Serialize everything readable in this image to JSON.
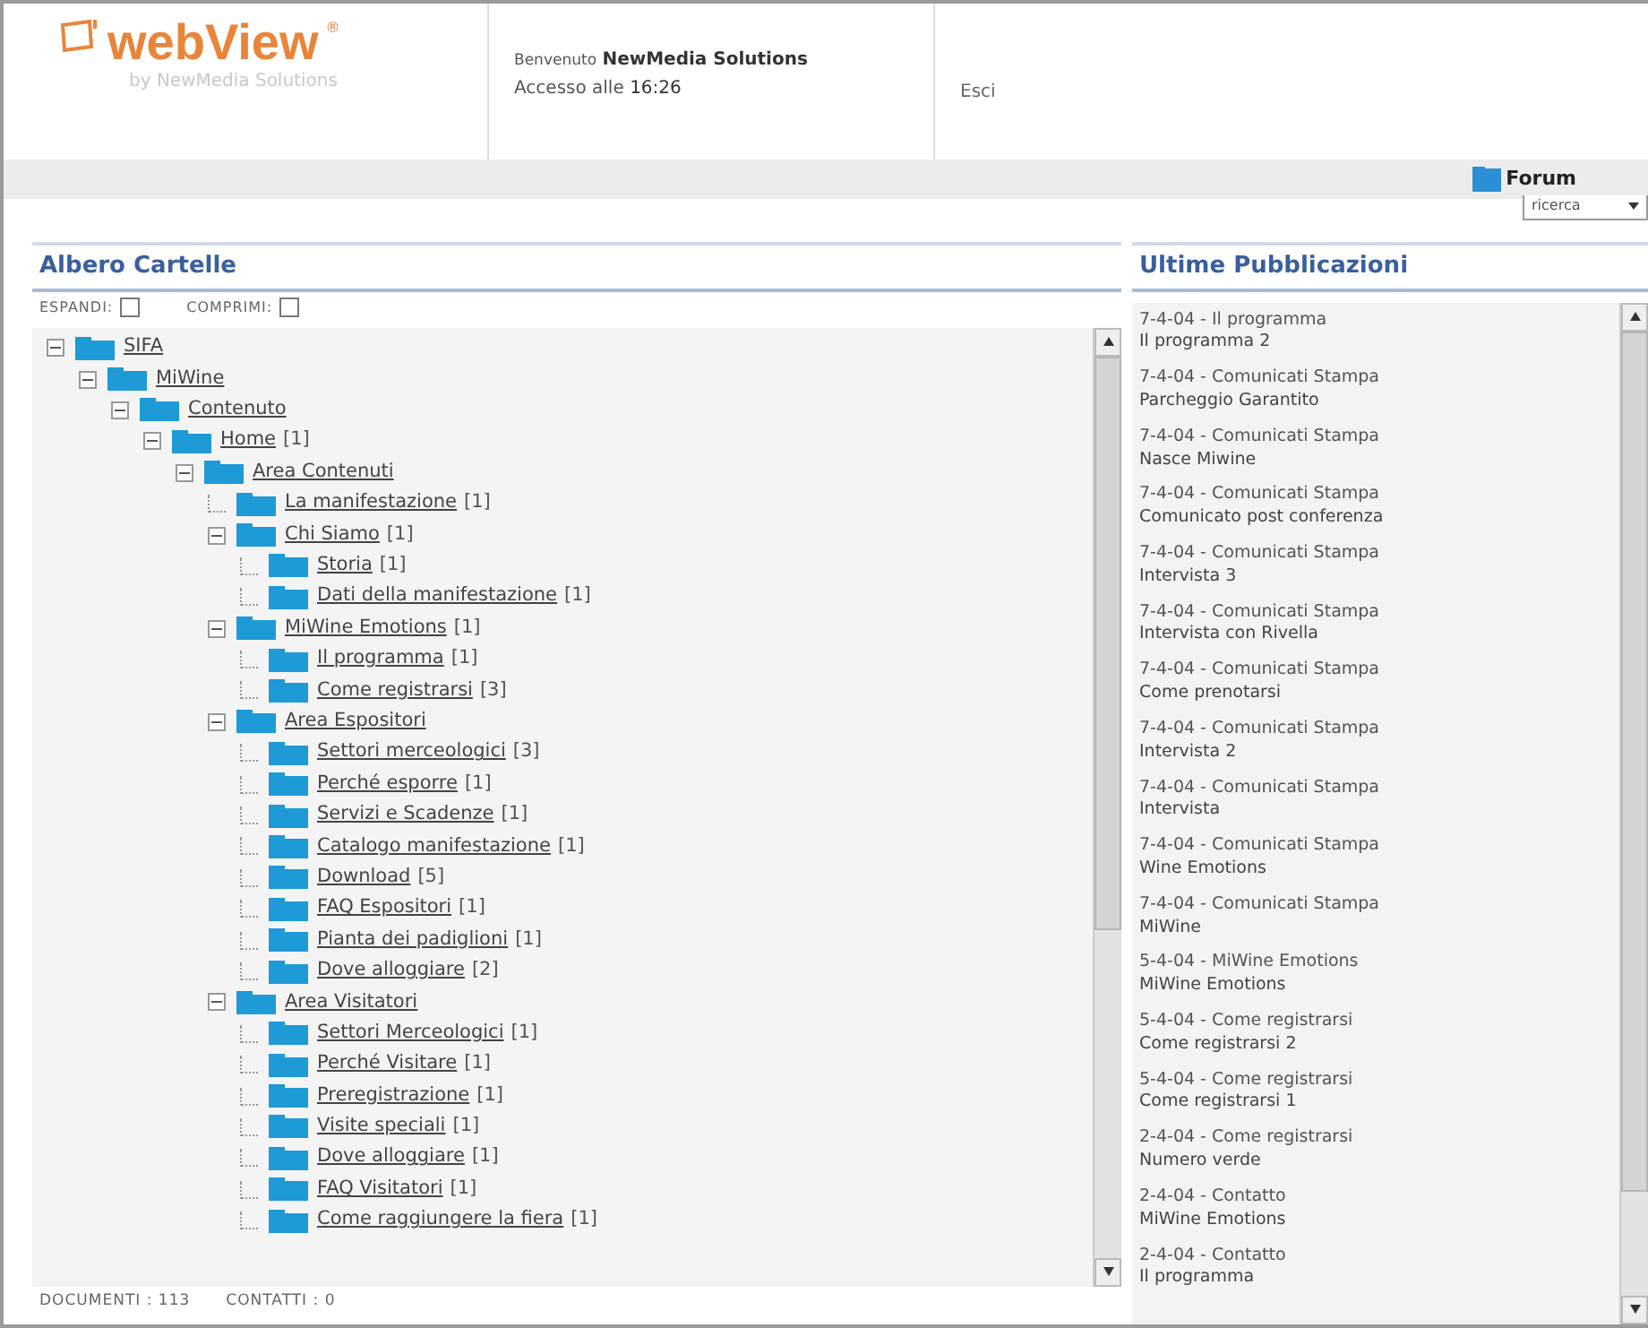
{
  "header": {
    "logo": "webView",
    "logo_mark": "®",
    "tagline": "by NewMedia Solutions",
    "welcome_label": "Benvenuto",
    "user": "NewMedia Solutions",
    "access_label": "Accesso alle",
    "access_time": "16:26",
    "exit": "Esci"
  },
  "toolbar": {
    "forum": "Forum",
    "search_select": "ricerca"
  },
  "folders": {
    "title": "Albero Cartelle",
    "expand": "ESPANDI:",
    "collapse": "COMPRIMI:",
    "tree": [
      {
        "label": "SIFA",
        "expanded": true,
        "children": [
          {
            "label": "MiWine",
            "expanded": true,
            "children": [
              {
                "label": "Contenuto",
                "expanded": true,
                "children": [
                  {
                    "label": "Home",
                    "count": "[1]",
                    "expanded": true,
                    "children": [
                      {
                        "label": "Area Contenuti",
                        "expanded": true,
                        "children": [
                          {
                            "label": "La manifestazione",
                            "count": "[1]"
                          },
                          {
                            "label": "Chi Siamo",
                            "count": "[1]",
                            "expanded": true,
                            "children": [
                              {
                                "label": "Storia",
                                "count": "[1]"
                              },
                              {
                                "label": "Dati della manifestazione",
                                "count": "[1]"
                              }
                            ]
                          },
                          {
                            "label": "MiWine Emotions",
                            "count": "[1]",
                            "expanded": true,
                            "children": [
                              {
                                "label": "Il programma",
                                "count": "[1]"
                              },
                              {
                                "label": "Come registrarsi",
                                "count": "[3]"
                              }
                            ]
                          },
                          {
                            "label": "Area Espositori",
                            "expanded": true,
                            "children": [
                              {
                                "label": "Settori merceologici",
                                "count": "[3]"
                              },
                              {
                                "label": "Perché esporre",
                                "count": "[1]"
                              },
                              {
                                "label": "Servizi e Scadenze",
                                "count": "[1]"
                              },
                              {
                                "label": "Catalogo manifestazione",
                                "count": "[1]"
                              },
                              {
                                "label": "Download",
                                "count": "[5]"
                              },
                              {
                                "label": "FAQ Espositori",
                                "count": "[1]"
                              },
                              {
                                "label": "Pianta dei padiglioni",
                                "count": "[1]"
                              },
                              {
                                "label": "Dove alloggiare",
                                "count": "[2]"
                              }
                            ]
                          },
                          {
                            "label": "Area Visitatori",
                            "expanded": true,
                            "children": [
                              {
                                "label": "Settori Merceologici",
                                "count": "[1]"
                              },
                              {
                                "label": "Perché Visitare",
                                "count": "[1]"
                              },
                              {
                                "label": "Preregistrazione",
                                "count": "[1]"
                              },
                              {
                                "label": "Visite speciali",
                                "count": "[1]"
                              },
                              {
                                "label": "Dove alloggiare",
                                "count": "[1]"
                              },
                              {
                                "label": "FAQ Visitatori",
                                "count": "[1]"
                              },
                              {
                                "label": "Come raggiungere la fiera",
                                "count": "[1]"
                              }
                            ]
                          }
                        ]
                      }
                    ]
                  }
                ]
              }
            ]
          }
        ]
      }
    ],
    "footer": [
      {
        "label": "DOCUMENTI :",
        "value": "113"
      },
      {
        "label": "CONTATTI :",
        "value": "0"
      }
    ]
  },
  "publications": {
    "title": "Ultime Pubblicazioni",
    "items": [
      {
        "heading": "7-4-04 - Il programma",
        "subtitle": "Il programma 2"
      },
      {
        "heading": "7-4-04 - Comunicati Stampa",
        "subtitle": "Parcheggio Garantito"
      },
      {
        "heading": "7-4-04 - Comunicati Stampa",
        "subtitle": "Nasce Miwine"
      },
      {
        "heading": "7-4-04 - Comunicati Stampa",
        "subtitle": "Comunicato post conferenza"
      },
      {
        "heading": "7-4-04 - Comunicati Stampa",
        "subtitle": "Intervista 3"
      },
      {
        "heading": "7-4-04 - Comunicati Stampa",
        "subtitle": "Intervista con Rivella"
      },
      {
        "heading": "7-4-04 - Comunicati Stampa",
        "subtitle": "Come prenotarsi"
      },
      {
        "heading": "7-4-04 - Comunicati Stampa",
        "subtitle": "Intervista 2"
      },
      {
        "heading": "7-4-04 - Comunicati Stampa",
        "subtitle": "Intervista"
      },
      {
        "heading": "7-4-04 - Comunicati Stampa",
        "subtitle": "Wine Emotions"
      },
      {
        "heading": "7-4-04 - Comunicati Stampa",
        "subtitle": "MiWine"
      },
      {
        "heading": "5-4-04 - MiWine Emotions",
        "subtitle": "MiWine Emotions"
      },
      {
        "heading": "5-4-04 - Come registrarsi",
        "subtitle": "Come registrarsi 2"
      },
      {
        "heading": "5-4-04 - Come registrarsi",
        "subtitle": "Come registrarsi 1"
      },
      {
        "heading": "2-4-04 - Come registrarsi",
        "subtitle": "Numero verde"
      },
      {
        "heading": "2-4-04 - Contatto",
        "subtitle": "MiWine Emotions"
      },
      {
        "heading": "2-4-04 - Contatto",
        "subtitle": "Il programma"
      }
    ]
  }
}
